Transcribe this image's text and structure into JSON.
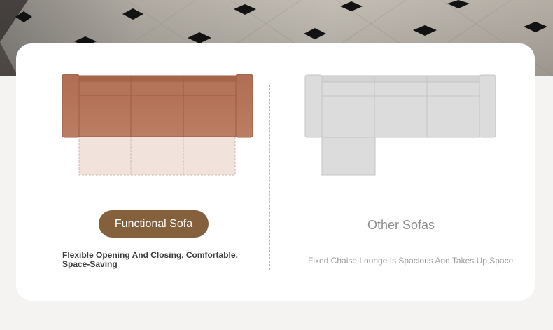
{
  "left": {
    "label": "Functional Sofa",
    "description": "Flexible Opening And Closing, Comfortable, Space-Saving"
  },
  "right": {
    "label": "Other Sofas",
    "description": "Fixed Chaise Lounge Is Spacious And Takes Up Space"
  },
  "colors": {
    "sofa_brown": "#b3735a",
    "pill_brown": "#85603d",
    "extended_seat": "#f1e3dc",
    "grey_sofa": "#dcdcdc"
  }
}
